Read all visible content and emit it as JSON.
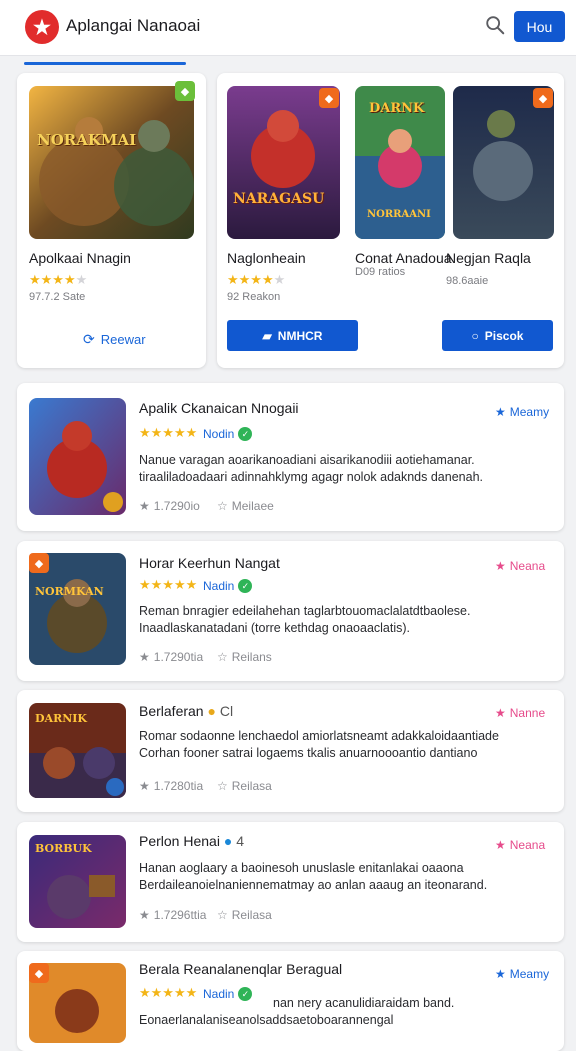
{
  "header": {
    "title": "Aplangai Nanaoai",
    "action_label": "Hou"
  },
  "featured": [
    {
      "name": "Apolkaai Nnagin",
      "rating": 3.5,
      "meta": "97.7.2 Sate",
      "action_label": "Reewar"
    },
    {
      "name": "Naglonheain",
      "rating": 3.5,
      "meta": "92 Reakon",
      "action_label": "NMHCR"
    },
    {
      "name": "Conat Anadoua",
      "meta": "D09 ratios"
    },
    {
      "name": "Negjan Raqla",
      "meta": "98.6aaie",
      "action_label": "Piscok"
    }
  ],
  "featured_art_text": {
    "one": "NORAKMAI",
    "two": "NARAGASU",
    "three": "DARNK",
    "three_sub": "NORRAANI"
  },
  "list": [
    {
      "title": "Apalik Ckanaican Nnogaii",
      "verified_label": "Nodin",
      "badge": "Meamy",
      "badge_color": "#1a66d8",
      "desc1": "Nanue varagan aoarikanoadiani aisarikanodiii aotiehamanar.",
      "desc2": "tiraaliladoadaari adinnahklymg agagr nolok adaknds danenah.",
      "stat1": "1.7290io",
      "stat2": "Meilaee"
    },
    {
      "title": "Horar Keerhun Nangat",
      "verified_label": "Nadin",
      "badge": "Neana",
      "badge_color": "#e64b8b",
      "desc1": "Reman bnragier edeilahehan taglarbtouomaclalatdtbaolese.",
      "desc2": "Inaadlaskanatadani (torre kethdag onaoaaclatis).",
      "stat1": "1.7290tia",
      "stat2": "Reilans"
    },
    {
      "title": "Berlaferan",
      "title_suffix": "Cl",
      "badge": "Nanne",
      "badge_color": "#e64b8b",
      "desc1": "Romar sodaonne lenchaedol amiorlatsneamt adakkaloidaantiade",
      "desc2": "Corhan fooner satrai logaems tkalis anuarnoooantio dantiano",
      "stat1": "1.7280tia",
      "stat2": "Reilasa"
    },
    {
      "title": "Perlon Henai",
      "title_suffix": "4",
      "badge": "Neana",
      "badge_color": "#e64b8b",
      "desc1": "Hanan aoglaary a baoinesoh unuslasle enitanlakai oaaona",
      "desc2": "Berdaileanoielnaniennematmay ao anlan aaaug an iteonarand.",
      "stat1": "1.7296ttia",
      "stat2": "Reilasa"
    },
    {
      "title": "Berala Reanalanenqlar Beragual",
      "verified_label": "Nadin",
      "badge": "Meamy",
      "badge_color": "#1a66d8",
      "desc1": "nan nery acanulidiaraidam band.",
      "desc2": "Eonaerlanalaniseanolsaddsaetoboarannengal"
    }
  ]
}
